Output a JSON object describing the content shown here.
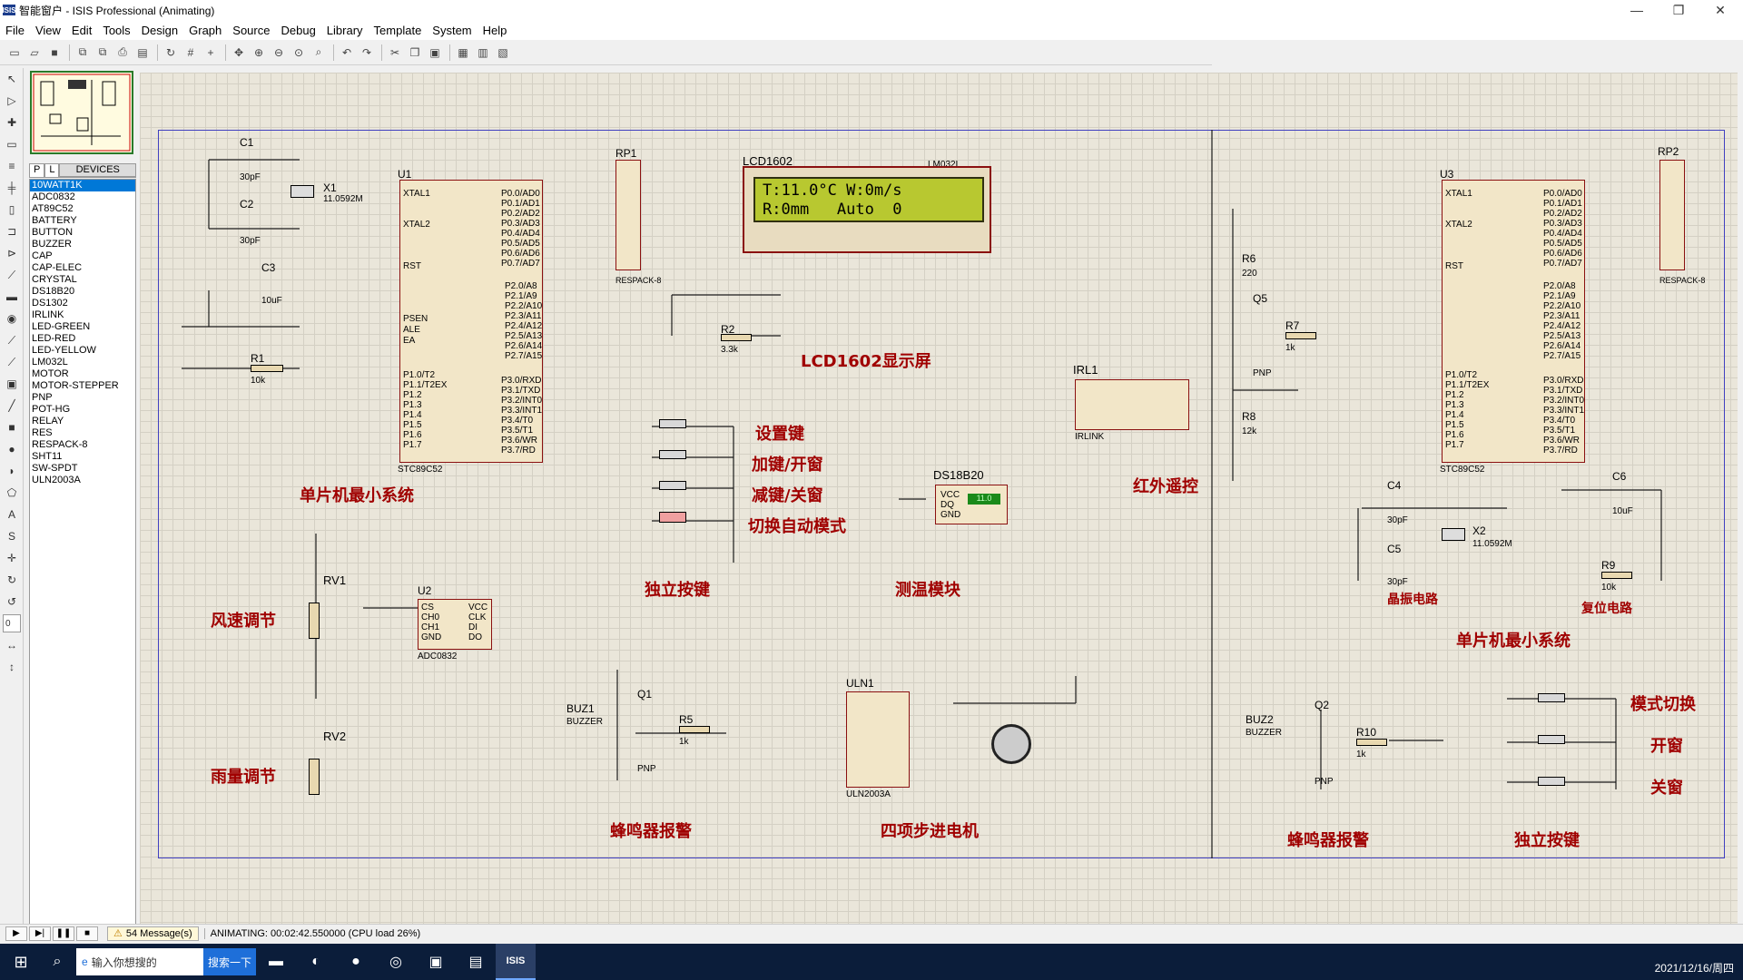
{
  "window": {
    "app_icon_text": "ISIS",
    "title": "智能窗户 - ISIS Professional (Animating)",
    "controls": {
      "minimize": "—",
      "maximize": "❐",
      "close": "✕"
    }
  },
  "menu": [
    "File",
    "View",
    "Edit",
    "Tools",
    "Design",
    "Graph",
    "Source",
    "Debug",
    "Library",
    "Template",
    "System",
    "Help"
  ],
  "toolbar_icons": [
    "new-icon",
    "open-icon",
    "save-icon",
    "import-icon",
    "export-icon",
    "print-icon",
    "print-setup-icon",
    "refresh-icon",
    "grid-icon",
    "origin-icon",
    "pan-icon",
    "zoom-in-icon",
    "zoom-out-icon",
    "zoom-all-icon",
    "zoom-area-icon",
    "undo-icon",
    "redo-icon",
    "cut-icon",
    "copy-icon",
    "paste-icon",
    "block-copy-icon",
    "block-move-icon",
    "block-rotate-icon"
  ],
  "left_tools": [
    "select-icon",
    "component-icon",
    "junction-icon",
    "wire-label-icon",
    "text-script-icon",
    "bus-icon",
    "subcircuit-icon",
    "terminal-icon",
    "pin-icon",
    "graph-icon",
    "tape-icon",
    "generator-icon",
    "probe-v-icon",
    "probe-i-icon",
    "instrument-icon",
    "line-icon",
    "box-icon",
    "circle-icon",
    "arc-icon",
    "path-icon",
    "text-icon",
    "symbol-icon",
    "marker-icon",
    "rotate-cw-icon",
    "rotate-ccw-icon",
    "flip-h-icon",
    "flip-v-icon"
  ],
  "rotation_value": "0",
  "device_panel": {
    "tabs": [
      "P",
      "L"
    ],
    "title": "DEVICES",
    "selected": "10WATT1K",
    "devices": [
      "10WATT1K",
      "ADC0832",
      "AT89C52",
      "BATTERY",
      "BUTTON",
      "BUZZER",
      "CAP",
      "CAP-ELEC",
      "CRYSTAL",
      "DS18B20",
      "DS1302",
      "IRLINK",
      "LED-GREEN",
      "LED-RED",
      "LED-YELLOW",
      "LM032L",
      "MOTOR",
      "MOTOR-STEPPER",
      "PNP",
      "POT-HG",
      "RELAY",
      "RES",
      "RESPACK-8",
      "SHT11",
      "SW-SPDT",
      "ULN2003A"
    ]
  },
  "schematic": {
    "lcd": {
      "ref": "LCD1602",
      "part": "LM032L",
      "line1": "T:11.0°C W:0m/s",
      "line2": "R:0mm   Auto  0"
    },
    "labels": {
      "lcd_caption": "LCD1602显示屏",
      "mcu_min_left": "单片机最小系统",
      "mcu_min_right": "单片机最小系统",
      "set_key": "设置键",
      "plus_key": "加键/开窗",
      "minus_key": "减键/关窗",
      "auto_key": "切换自动模式",
      "indep_keys_left": "独立按键",
      "indep_keys_right": "独立按键",
      "temp_module": "测温模块",
      "ir_remote": "红外遥控",
      "wind_adj": "风速调节",
      "rain_adj": "雨量调节",
      "buzzer_left": "蜂鸣器报警",
      "buzzer_right": "蜂鸣器报警",
      "stepper": "四项步进电机",
      "crystal_circuit": "晶振电路",
      "reset_circuit": "复位电路",
      "mode_switch": "模式切换",
      "open_window": "开窗",
      "close_window": "关窗"
    },
    "refs": {
      "u1": "U1",
      "u1_part": "STC89C52",
      "u3": "U3",
      "u3_part": "STC89C52",
      "rp1": "RP1",
      "rp2": "RP2",
      "respack": "RESPACK-8",
      "c1": "C1",
      "c2": "C2",
      "c3": "C3",
      "c4": "C4",
      "c5": "C5",
      "c6": "C6",
      "x1": "X1",
      "x2": "X2",
      "xtal_val": "11.0592M",
      "r1": "R1",
      "r2": "R2",
      "r5": "R5",
      "r6": "R6",
      "r7": "R7",
      "r8": "R8",
      "r9": "R9",
      "r10": "R10",
      "rv1": "RV1",
      "rv2": "RV2",
      "u2": "U2",
      "u2_part": "ADC0832",
      "q1": "Q1",
      "q2": "Q2",
      "q5": "Q5",
      "pnp": "PNP",
      "buz1": "BUZ1",
      "buz2": "BUZ2",
      "buzzer": "BUZZER",
      "uln1": "ULN1",
      "uln_part": "ULN2003A",
      "irl1": "IRL1",
      "irlink": "IRLINK",
      "ds": "DS18B20",
      "ds_temp": "11.0",
      "cap30": "30pF",
      "cap10u": "10uF",
      "r10k": "10k",
      "r1k": "1k",
      "r33k": "3.3k",
      "r220": "220",
      "r12k": "12k",
      "text": "<TEXT>"
    }
  },
  "status": {
    "messages": "54 Message(s)",
    "animating": "ANIMATING: 00:02:42.550000 (CPU load 26%)"
  },
  "taskbar": {
    "search_placeholder": "输入你想搜的",
    "search_button": "搜索一下",
    "clock": "2021/12/16/周四"
  }
}
